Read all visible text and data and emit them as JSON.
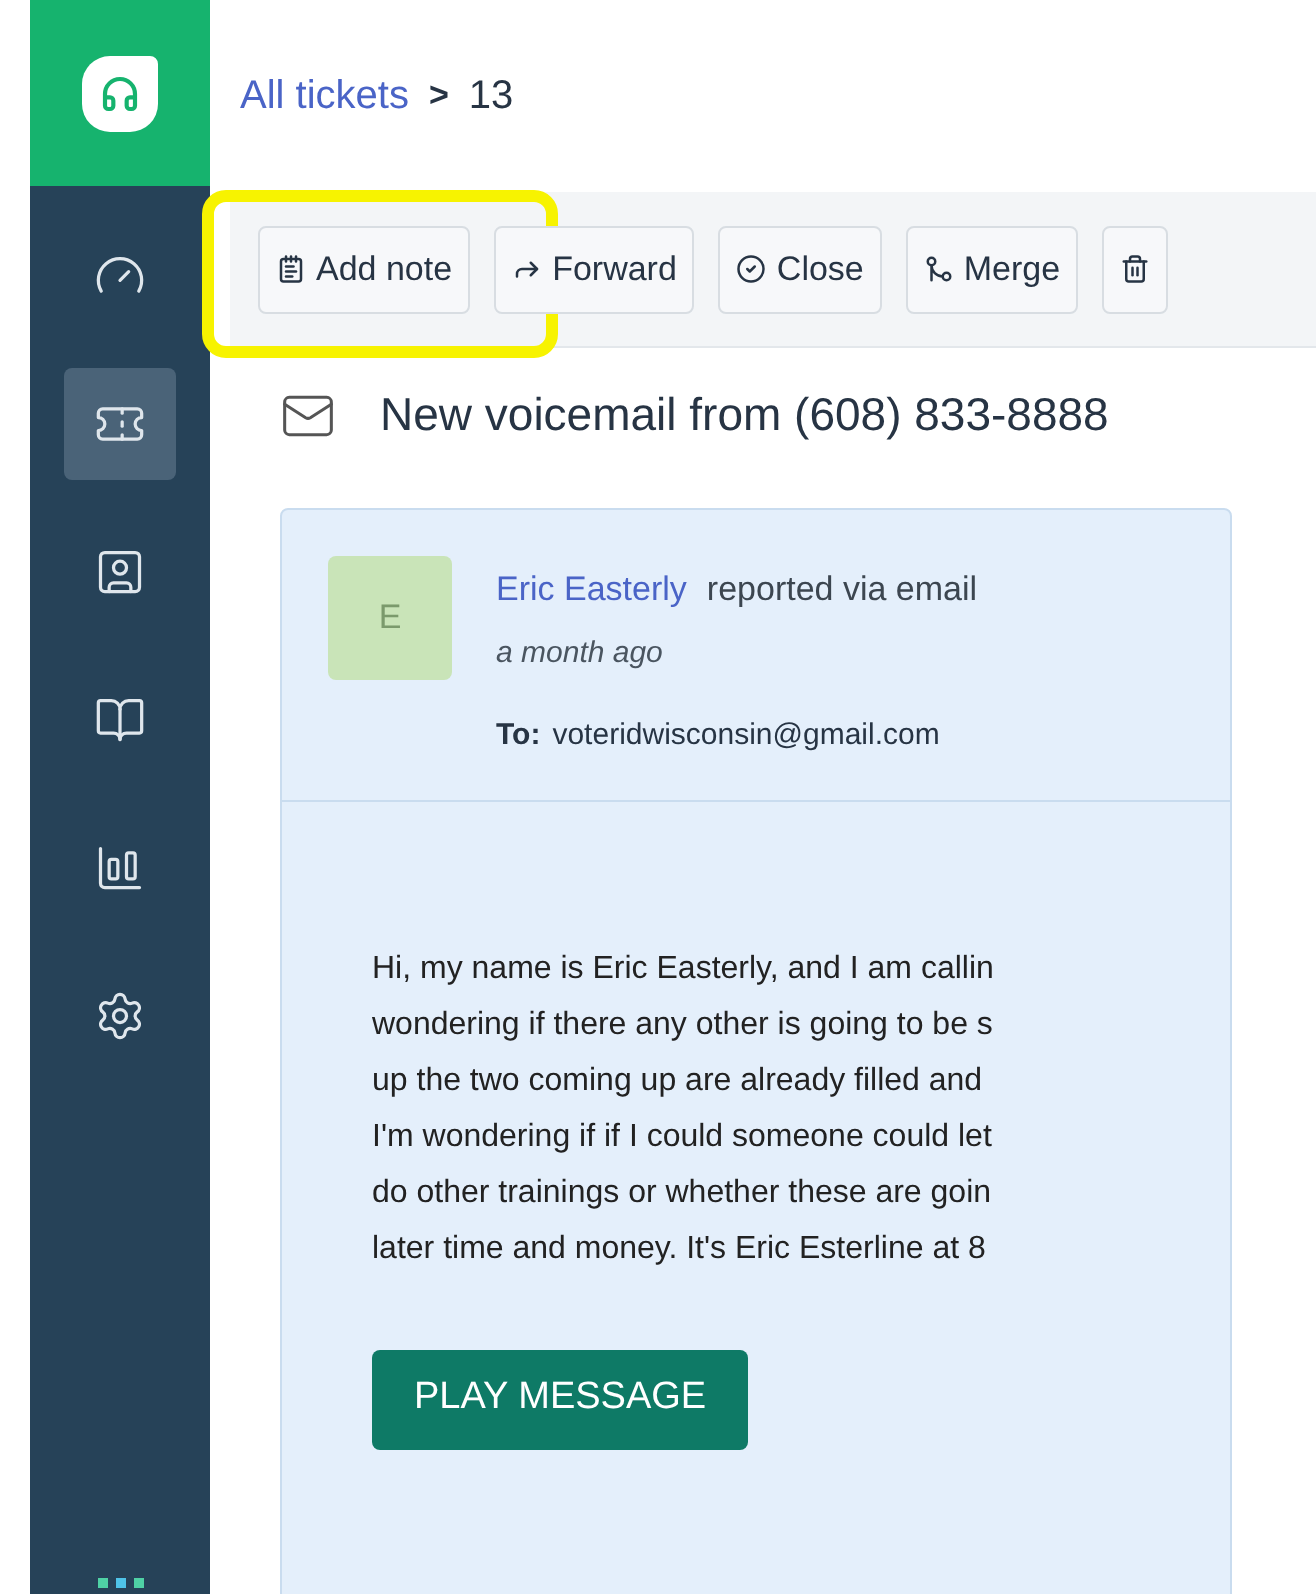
{
  "breadcrumb": {
    "link": "All tickets",
    "separator": ">",
    "current": "13"
  },
  "sidebar": {
    "items": [
      {
        "kind": "dashboard",
        "selected": false
      },
      {
        "kind": "tickets",
        "selected": true
      },
      {
        "kind": "contacts",
        "selected": false
      },
      {
        "kind": "knowledge",
        "selected": false
      },
      {
        "kind": "reports",
        "selected": false
      },
      {
        "kind": "settings",
        "selected": false
      }
    ]
  },
  "toolbar": {
    "buttons": [
      {
        "kind": "note",
        "label": "Add note",
        "highlighted": true
      },
      {
        "kind": "forward",
        "label": "Forward",
        "highlighted": false
      },
      {
        "kind": "close",
        "label": "Close",
        "highlighted": false
      },
      {
        "kind": "merge",
        "label": "Merge",
        "highlighted": false
      },
      {
        "kind": "delete",
        "highlighted": false
      }
    ]
  },
  "ticket": {
    "title": "New voicemail from (608) 833-8888"
  },
  "message": {
    "avatar": "E",
    "author": "Eric Easterly",
    "action": "reported via email",
    "time": "a month ago",
    "to_label": "To:",
    "to": "voteridwisconsin@gmail.com",
    "body_lines": [
      "Hi, my name is Eric Easterly, and I am callin",
      "wondering if there any other is going to be s",
      "up the two coming up are already filled and",
      "I'm wondering if if I could someone could let",
      "do other trainings or whether these are goin",
      "later time and money. It's Eric Esterline at 8"
    ],
    "button": "PLAY MESSAGE"
  }
}
